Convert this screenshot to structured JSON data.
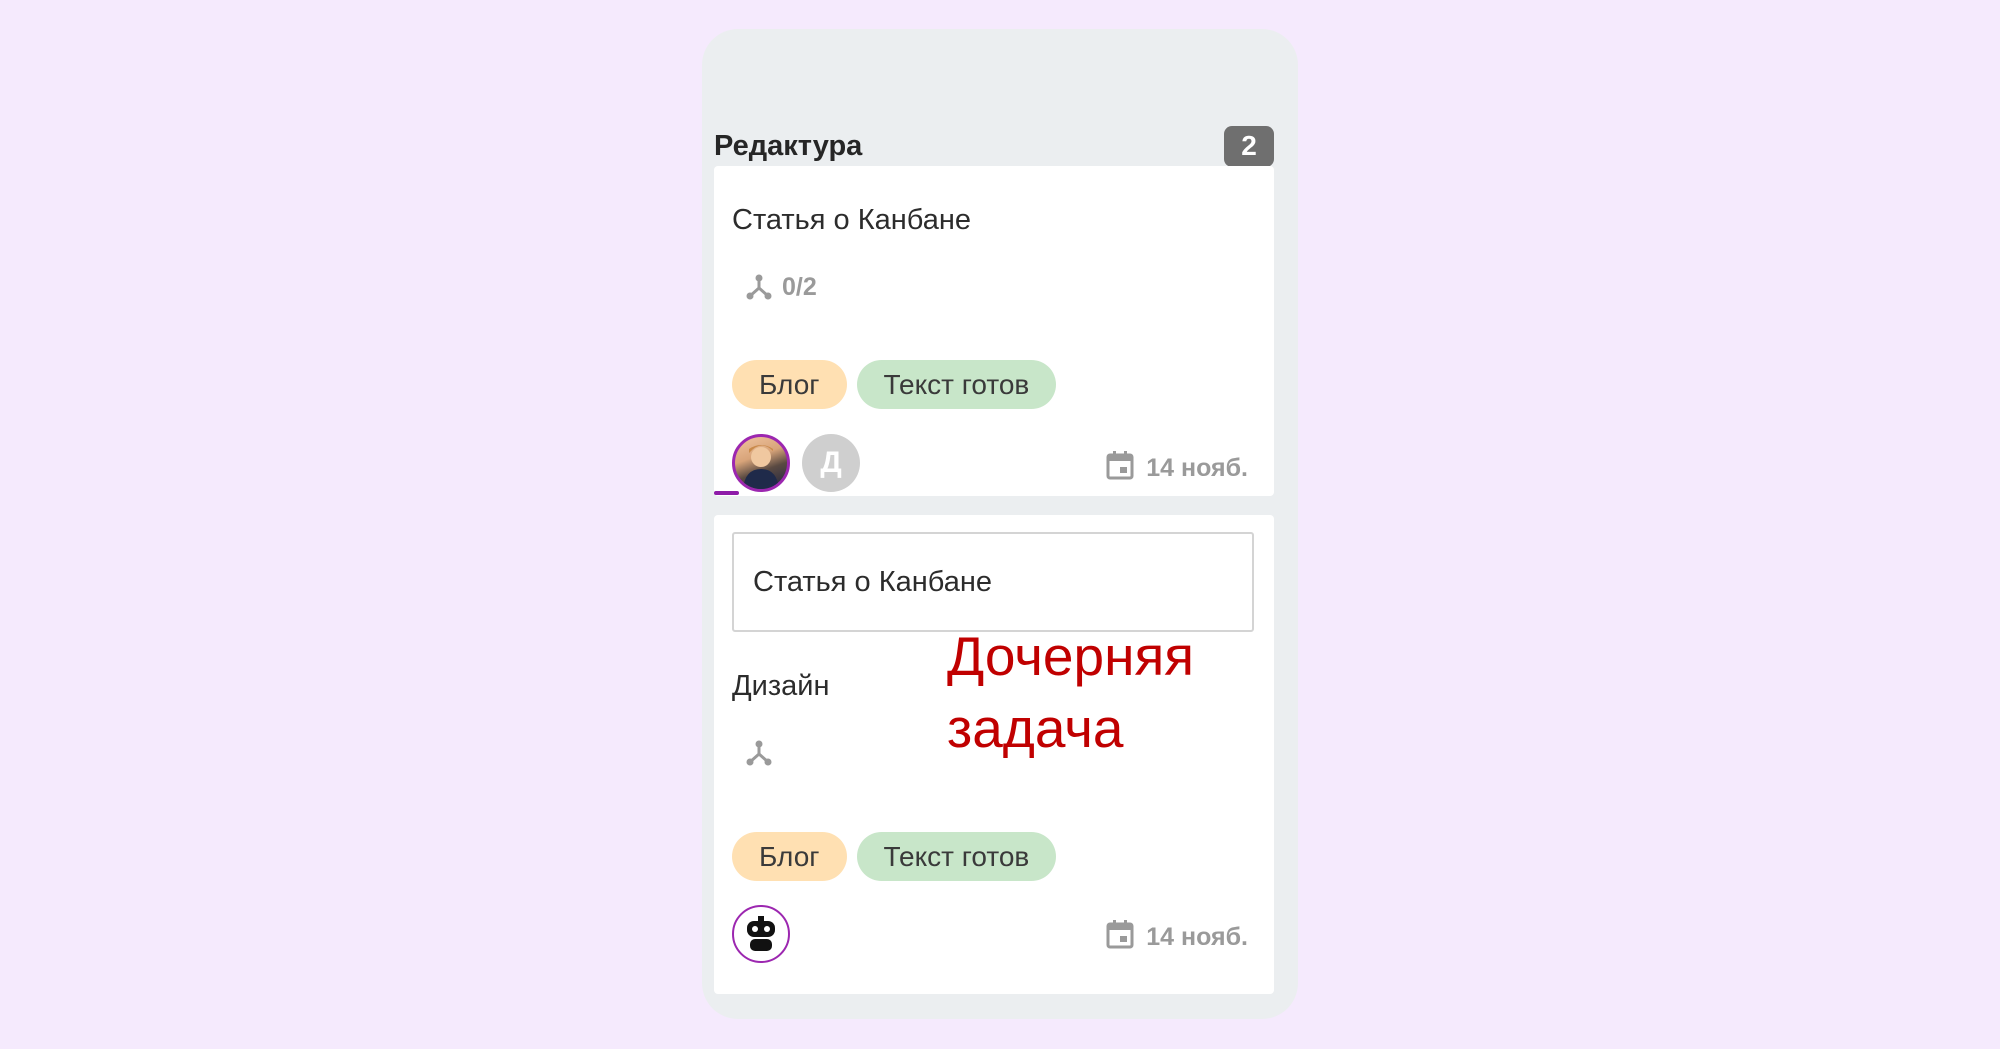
{
  "column": {
    "title": "Редактура",
    "count": "2"
  },
  "cards": [
    {
      "title": "Статья о Канбане",
      "subtasks": "0/2",
      "tags": [
        {
          "label": "Блог",
          "color": "#ffe0b2"
        },
        {
          "label": "Текст готов",
          "color": "#c8e6c9"
        }
      ],
      "avatars": [
        {
          "type": "photo"
        },
        {
          "type": "letter",
          "letter": "Д"
        }
      ],
      "due": "14 нояб."
    },
    {
      "parent": "Статья о Канбане",
      "title": "Дизайн",
      "tags": [
        {
          "label": "Блог",
          "color": "#ffe0b2"
        },
        {
          "label": "Текст готов",
          "color": "#c8e6c9"
        }
      ],
      "avatars": [
        {
          "type": "robot"
        }
      ],
      "due": "14 нояб."
    }
  ],
  "annotation": {
    "line1": "Дочерняя",
    "line2": "задача",
    "color": "#c00000"
  },
  "colors": {
    "accent": "#9c27b0",
    "background": "#f5eafd",
    "column": "#ebeef0"
  }
}
